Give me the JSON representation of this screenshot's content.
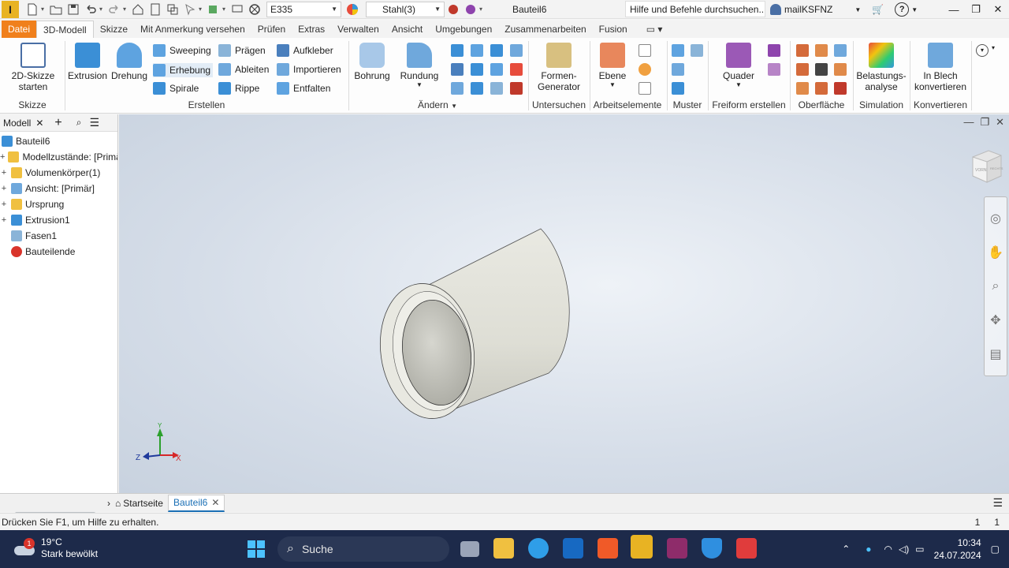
{
  "qat": {
    "material_field": "E335",
    "appearance_field": "Stahl(3)",
    "document_name": "Bauteil6",
    "help_search": "Hilfe und Befehle durchsuchen...",
    "user": "mailKSFNZ",
    "app_letter": "I"
  },
  "tabs": [
    "Datei",
    "3D-Modell",
    "Skizze",
    "Mit Anmerkung versehen",
    "Prüfen",
    "Extras",
    "Verwalten",
    "Ansicht",
    "Umgebungen",
    "Zusammenarbeiten",
    "Fusion"
  ],
  "ribbon": {
    "sketch": {
      "label1": "2D-Skizze",
      "label2": "starten",
      "group": "Skizze"
    },
    "create": {
      "extrusion": "Extrusion",
      "rotation": "Drehung",
      "sweeping": "Sweeping",
      "loft": "Erhebung",
      "spiral": "Spirale",
      "emboss": "Prägen",
      "derive": "Ableiten",
      "rib": "Rippe",
      "decal": "Aufkleber",
      "import": "Importieren",
      "unwrap": "Entfalten",
      "group": "Erstellen"
    },
    "modify": {
      "hole": "Bohrung",
      "fillet": "Rundung",
      "group": "Ändern"
    },
    "explore": {
      "label1": "Formen-",
      "label2": "Generator",
      "group": "Untersuchen"
    },
    "workfeatures": {
      "plane": "Ebene",
      "group": "Arbeitselemente"
    },
    "pattern": {
      "group": "Muster"
    },
    "freeform": {
      "box": "Quader",
      "group": "Freiform erstellen"
    },
    "surface": {
      "group": "Oberfläche"
    },
    "simulation": {
      "label1": "Belastungs-",
      "label2": "analyse",
      "group": "Simulation"
    },
    "convert": {
      "label1": "In Blech",
      "label2": "konvertieren",
      "group": "Konvertieren"
    }
  },
  "browser": {
    "title": "Modell",
    "items": [
      {
        "label": "Bauteil6",
        "icon": "part-icon",
        "color": "#3b8fd6"
      },
      {
        "label": "Modellzustände: [Primär]",
        "icon": "folder-icon",
        "color": "#f0c040"
      },
      {
        "label": "Volumenkörper(1)",
        "icon": "folder-icon",
        "color": "#f0c040"
      },
      {
        "label": "Ansicht: [Primär]",
        "icon": "view-icon",
        "color": "#6fa8dc"
      },
      {
        "label": "Ursprung",
        "icon": "folder-icon",
        "color": "#f0c040"
      },
      {
        "label": "Extrusion1",
        "icon": "extrusion-icon",
        "color": "#3b8fd6"
      },
      {
        "label": "Fasen1",
        "icon": "chamfer-icon",
        "color": "#8ab4d8"
      },
      {
        "label": "Bauteilende",
        "icon": "end-of-part-icon",
        "color": "#d9342b"
      }
    ]
  },
  "doc_tabs": {
    "home": "Startseite",
    "current": "Bauteil6"
  },
  "status": {
    "message": "Drücken Sie F1, um Hilfe zu erhalten.",
    "n1": "1",
    "n2": "1"
  },
  "taskbar": {
    "temperature": "19°C",
    "weather": "Stark bewölkt",
    "weather_badge": "1",
    "search": "Suche",
    "time": "10:34",
    "date": "24.07.2024"
  },
  "viewcube": {
    "front": "VORN",
    "right": "RECHTS"
  },
  "triad": {
    "x": "X",
    "y": "Y",
    "z": "Z"
  }
}
